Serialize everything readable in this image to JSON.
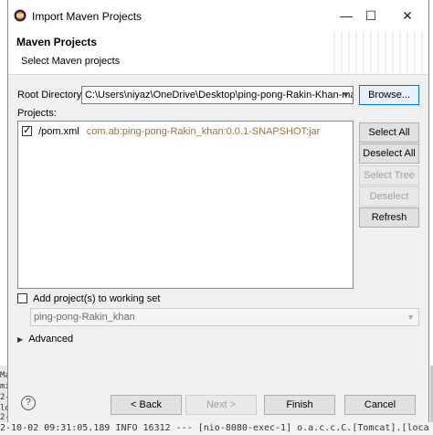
{
  "window": {
    "title": "Import Maven Projects"
  },
  "header": {
    "title": "Maven Projects",
    "subtitle": "Select Maven projects"
  },
  "root_directory": {
    "label": "Root Directory:",
    "value": "C:\\Users\\niyaz\\OneDrive\\Desktop\\ping-pong-Rakin-Khan-main\\",
    "browse_label": "Browse..."
  },
  "projects": {
    "label": "Projects:",
    "items": [
      {
        "checked": true,
        "name": "/pom.xml",
        "artifact": "com.ab:ping-pong-Rakin_khan:0.0.1-SNAPSHOT:jar"
      }
    ],
    "buttons": {
      "select_all": "Select All",
      "deselect_all": "Deselect All",
      "select_tree": "Select Tree",
      "deselect_tree": "Deselect Tree",
      "refresh": "Refresh"
    }
  },
  "working_set": {
    "checkbox_label": "Add project(s) to working set",
    "checked": false,
    "value": "ping-pong-Rakin_khan"
  },
  "advanced": {
    "label": "Advanced"
  },
  "footer": {
    "back": "< Back",
    "next": "Next >",
    "finish": "Finish",
    "cancel": "Cancel"
  },
  "background": {
    "left_lines": [
      "Ma",
      "mi",
      "2-",
      "lo",
      "2-",
      "lo"
    ],
    "console_line": "2-10-02 09:31:05.189  INFO 16312 --- [nio-8080-exec-1] o.a.c.c.C.[Tomcat].[loca"
  },
  "colors": {
    "accent": "#0078d7",
    "artifact": "#a07038"
  },
  "icons": {
    "help": "help-icon",
    "minimize": "minimize-icon",
    "maximize": "maximize-icon",
    "close": "close-icon"
  }
}
